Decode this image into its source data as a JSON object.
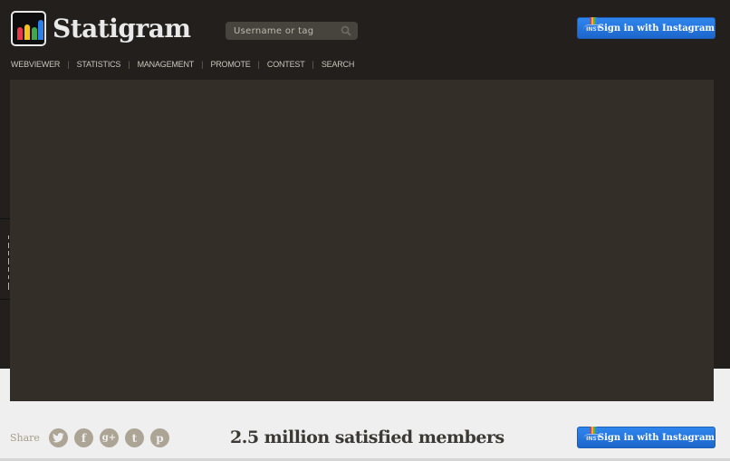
{
  "brand": {
    "name": "Statigram",
    "logo_bar_colors": [
      "#e8394b",
      "#f5c21b",
      "#3fa84a",
      "#2f7fe6"
    ]
  },
  "search": {
    "placeholder": "Username or tag",
    "value": "",
    "icon": "search-icon"
  },
  "signin": {
    "label": "Sign in with Instagram",
    "badge": "INST",
    "icon": "instagram-camera-icon"
  },
  "nav": {
    "items": [
      {
        "label": "WEBVIEWER"
      },
      {
        "label": "STATISTICS"
      },
      {
        "label": "MANAGEMENT"
      },
      {
        "label": "PROMOTE"
      },
      {
        "label": "CONTEST"
      },
      {
        "label": "SEARCH"
      }
    ],
    "separator": "|"
  },
  "footer": {
    "share_label": "Share",
    "social": [
      {
        "name": "twitter",
        "glyph": "t"
      },
      {
        "name": "facebook",
        "glyph": "f"
      },
      {
        "name": "google-plus",
        "glyph": "g+"
      },
      {
        "name": "tumblr",
        "glyph": "t"
      },
      {
        "name": "pinterest",
        "glyph": "p"
      }
    ],
    "members_text": "2.5 million satisfied members",
    "signin_label": "Sign in with Instagram",
    "signin_badge": "INST"
  },
  "colors": {
    "header_bg": "#221f1c",
    "panel_bg": "#332f28",
    "page_bg": "#efefef",
    "button_blue": "#2a7ce6",
    "social_gray": "#aca596"
  }
}
